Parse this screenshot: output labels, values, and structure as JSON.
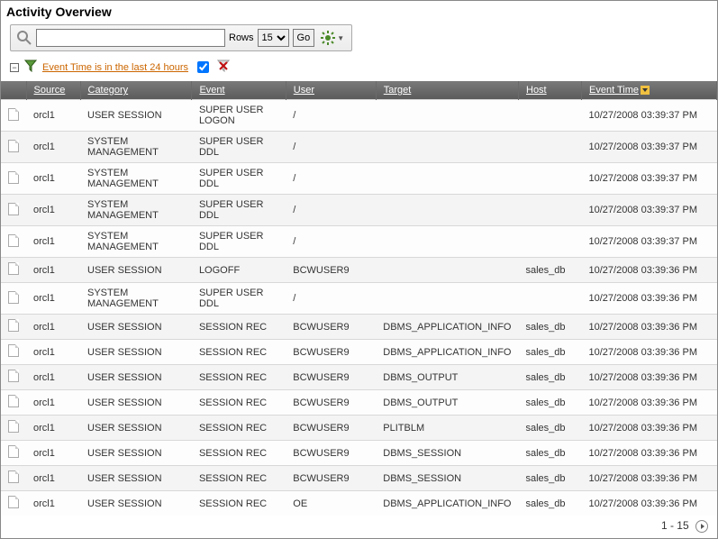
{
  "title": "Activity Overview",
  "toolbar": {
    "rows_label": "Rows",
    "rows_value": "15",
    "go_label": "Go",
    "search_value": ""
  },
  "filter": {
    "text": "Event Time is in the last 24 hours",
    "enabled": true
  },
  "columns": {
    "source": "Source",
    "category": "Category",
    "event": "Event",
    "user": "User",
    "target": "Target",
    "host": "Host",
    "event_time": "Event Time"
  },
  "rows": [
    {
      "source": "orcl1",
      "category": "USER SESSION",
      "event": "SUPER USER LOGON",
      "user": "/",
      "target": "",
      "host": "",
      "time": "10/27/2008 03:39:37 PM"
    },
    {
      "source": "orcl1",
      "category": "SYSTEM MANAGEMENT",
      "event": "SUPER USER DDL",
      "user": "/",
      "target": "",
      "host": "",
      "time": "10/27/2008 03:39:37 PM"
    },
    {
      "source": "orcl1",
      "category": "SYSTEM MANAGEMENT",
      "event": "SUPER USER DDL",
      "user": "/",
      "target": "",
      "host": "",
      "time": "10/27/2008 03:39:37 PM"
    },
    {
      "source": "orcl1",
      "category": "SYSTEM MANAGEMENT",
      "event": "SUPER USER DDL",
      "user": "/",
      "target": "",
      "host": "",
      "time": "10/27/2008 03:39:37 PM"
    },
    {
      "source": "orcl1",
      "category": "SYSTEM MANAGEMENT",
      "event": "SUPER USER DDL",
      "user": "/",
      "target": "",
      "host": "",
      "time": "10/27/2008 03:39:37 PM"
    },
    {
      "source": "orcl1",
      "category": "USER SESSION",
      "event": "LOGOFF",
      "user": "BCWUSER9",
      "target": "",
      "host": "sales_db",
      "time": "10/27/2008 03:39:36 PM"
    },
    {
      "source": "orcl1",
      "category": "SYSTEM MANAGEMENT",
      "event": "SUPER USER DDL",
      "user": "/",
      "target": "",
      "host": "",
      "time": "10/27/2008 03:39:36 PM"
    },
    {
      "source": "orcl1",
      "category": "USER SESSION",
      "event": "SESSION REC",
      "user": "BCWUSER9",
      "target": "DBMS_APPLICATION_INFO",
      "host": "sales_db",
      "time": "10/27/2008 03:39:36 PM"
    },
    {
      "source": "orcl1",
      "category": "USER SESSION",
      "event": "SESSION REC",
      "user": "BCWUSER9",
      "target": "DBMS_APPLICATION_INFO",
      "host": "sales_db",
      "time": "10/27/2008 03:39:36 PM"
    },
    {
      "source": "orcl1",
      "category": "USER SESSION",
      "event": "SESSION REC",
      "user": "BCWUSER9",
      "target": "DBMS_OUTPUT",
      "host": "sales_db",
      "time": "10/27/2008 03:39:36 PM"
    },
    {
      "source": "orcl1",
      "category": "USER SESSION",
      "event": "SESSION REC",
      "user": "BCWUSER9",
      "target": "DBMS_OUTPUT",
      "host": "sales_db",
      "time": "10/27/2008 03:39:36 PM"
    },
    {
      "source": "orcl1",
      "category": "USER SESSION",
      "event": "SESSION REC",
      "user": "BCWUSER9",
      "target": "PLITBLM",
      "host": "sales_db",
      "time": "10/27/2008 03:39:36 PM"
    },
    {
      "source": "orcl1",
      "category": "USER SESSION",
      "event": "SESSION REC",
      "user": "BCWUSER9",
      "target": "DBMS_SESSION",
      "host": "sales_db",
      "time": "10/27/2008 03:39:36 PM"
    },
    {
      "source": "orcl1",
      "category": "USER SESSION",
      "event": "SESSION REC",
      "user": "BCWUSER9",
      "target": "DBMS_SESSION",
      "host": "sales_db",
      "time": "10/27/2008 03:39:36 PM"
    },
    {
      "source": "orcl1",
      "category": "USER SESSION",
      "event": "SESSION REC",
      "user": "OE",
      "target": "DBMS_APPLICATION_INFO",
      "host": "sales_db",
      "time": "10/27/2008 03:39:36 PM"
    }
  ],
  "pager": {
    "range": "1 - 15"
  }
}
